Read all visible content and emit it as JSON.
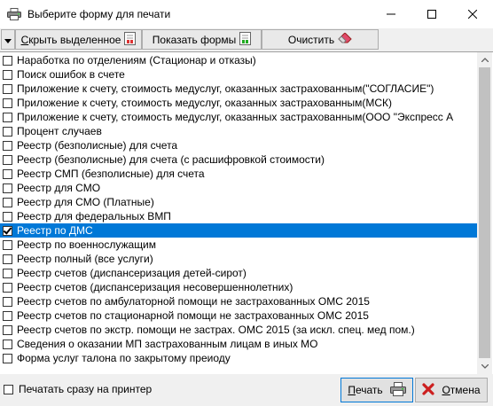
{
  "window": {
    "title": "Выберите форму для печати"
  },
  "toolbar": {
    "hide_selected_label": "Скрыть выделенное",
    "hide_selected_access": "С",
    "hide_selected_rest": "крыть выделенное",
    "show_forms_label": "Показать формы",
    "clear_label": "Очистить"
  },
  "list": {
    "items": [
      {
        "label": "Наработка по отделениям (Стационар и отказы)",
        "checked": false
      },
      {
        "label": "Поиск ошибок в счете",
        "checked": false
      },
      {
        "label": "Приложение к счету, стоимость медуслуг, оказанных застрахованным(\"СОГЛАСИЕ\")",
        "checked": false
      },
      {
        "label": "Приложение к счету, стоимость медуслуг, оказанных застрахованным(МСК)",
        "checked": false
      },
      {
        "label": "Приложение к счету, стоимость медуслуг, оказанных застрахованным(ООО \"Экспресс А",
        "checked": false
      },
      {
        "label": "Процент случаев",
        "checked": false
      },
      {
        "label": "Реестр (безполисные) для счета",
        "checked": false
      },
      {
        "label": "Реестр (безполисные) для счета (с расшифровкой стоимости)",
        "checked": false
      },
      {
        "label": "Реестр СМП (безполисные) для счета",
        "checked": false
      },
      {
        "label": "Реестр для СМО",
        "checked": false
      },
      {
        "label": "Реестр для СМО (Платные)",
        "checked": false
      },
      {
        "label": "Реестр для федеральных ВМП",
        "checked": false
      },
      {
        "label": "Реестр по ДМС",
        "checked": true
      },
      {
        "label": "Реестр по военнослужащим",
        "checked": false
      },
      {
        "label": "Реестр полный (все услуги)",
        "checked": false
      },
      {
        "label": "Реестр счетов (диспансеризация детей-сирот)",
        "checked": false
      },
      {
        "label": "Реестр счетов (диспансеризация несовершеннолетних)",
        "checked": false
      },
      {
        "label": "Реестр счетов по амбулаторной помощи не застрахованных ОМС 2015",
        "checked": false
      },
      {
        "label": "Реестр счетов по стационарной помощи не застрахованных ОМС 2015",
        "checked": false
      },
      {
        "label": "Реестр счетов по экстр. помощи не застрах. ОМС 2015 (за искл. спец. мед пом.)",
        "checked": false
      },
      {
        "label": "Сведения о оказании МП застрахованным лицам в иных МО",
        "checked": false
      },
      {
        "label": "Форма услуг талона по закрытому преиоду",
        "checked": false
      }
    ],
    "selected_index": 12
  },
  "footer": {
    "print_immediately_label": "Печатать сразу на принтер",
    "print_immediately_checked": false,
    "print_label": "Печать",
    "print_access": "П",
    "print_rest": "ечать",
    "cancel_label": "Отмена",
    "cancel_access": "О",
    "cancel_rest": "тмена"
  },
  "colors": {
    "selection": "#0078d7",
    "window_bg": "#f0f0f0",
    "cancel_icon": "#cc1f1f"
  },
  "icons": {
    "title": "printer-icon",
    "hide": "filter-hide-icon",
    "show": "filter-show-icon",
    "clear": "eraser-icon",
    "print": "printer-icon",
    "cancel": "red-x-icon"
  }
}
